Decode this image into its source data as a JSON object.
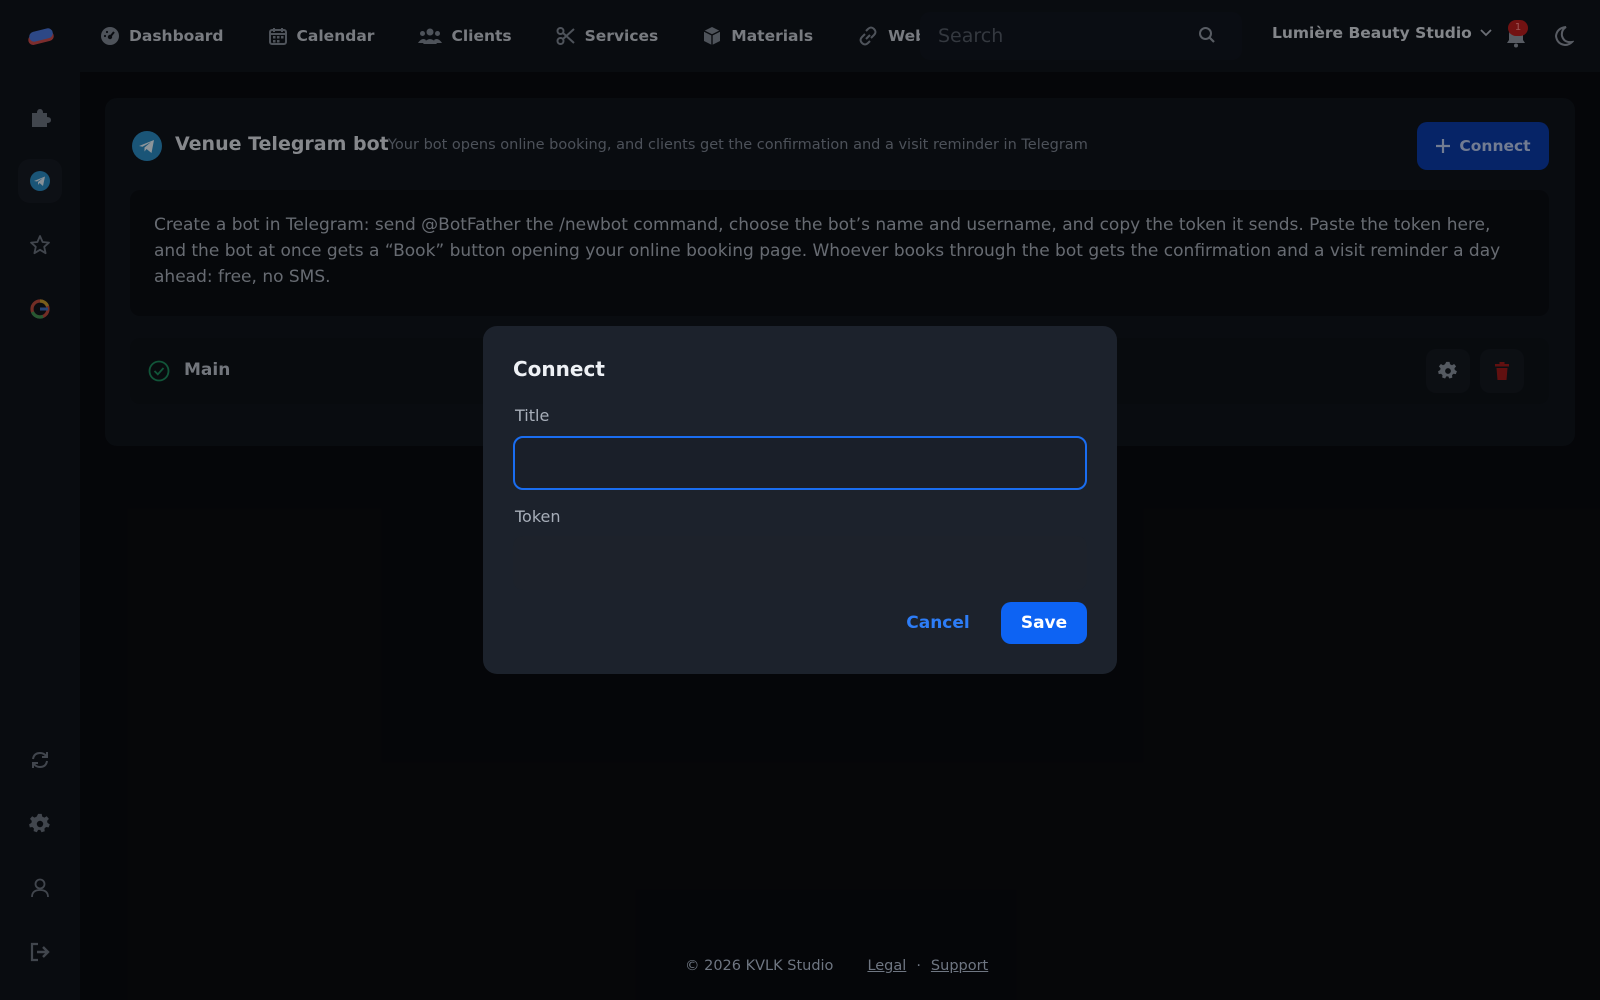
{
  "colors": {
    "accent": "#0d63f3",
    "focus_border": "#1a6df0",
    "danger": "#c81e1e",
    "success": "#1fa36b",
    "telegram": "#2aa1d8",
    "badge": "#b81d1d"
  },
  "topbar": {
    "logo_icon": "stacked-pill-logo-icon",
    "nav": [
      {
        "label": "Dashboard",
        "icon": "gauge-icon"
      },
      {
        "label": "Calendar",
        "icon": "calendar-icon"
      },
      {
        "label": "Clients",
        "icon": "users-icon"
      },
      {
        "label": "Services",
        "icon": "scissors-icon"
      },
      {
        "label": "Materials",
        "icon": "box-icon"
      },
      {
        "label": "Web a",
        "icon": "link-icon"
      }
    ],
    "search_placeholder": "Search",
    "org_name": "Lumière Beauty Studio",
    "notification_count": "1"
  },
  "sidebar": {
    "top_icons": [
      "puzzle-icon",
      "telegram-icon",
      "star-icon",
      "google-icon"
    ],
    "bottom_icons": [
      "sync-icon",
      "gear-icon",
      "user-icon",
      "logout-icon"
    ],
    "active": "telegram-icon"
  },
  "card": {
    "title": "Venue Telegram bot",
    "subtitle": "Your bot opens online booking, and clients get the confirmation and a visit reminder in Telegram",
    "connect_label": "Connect",
    "info_text": "Create a bot in Telegram: send @BotFather the /newbot command, choose the bot’s name and username, and copy the token it sends. Paste the token here, and the bot at once gets a “Book” button opening your online booking page. Whoever books through the bot gets the confirmation and a visit reminder a day ahead: free, no SMS.",
    "bots": [
      {
        "name": "Main",
        "status": "active"
      }
    ]
  },
  "modal": {
    "title": "Connect",
    "title_label": "Title",
    "title_value": "",
    "token_label": "Token",
    "token_value": "",
    "cancel_label": "Cancel",
    "save_label": "Save"
  },
  "footer": {
    "copyright": "© 2026 KVLK Studio",
    "legal": "Legal",
    "separator": "·",
    "support": "Support"
  }
}
